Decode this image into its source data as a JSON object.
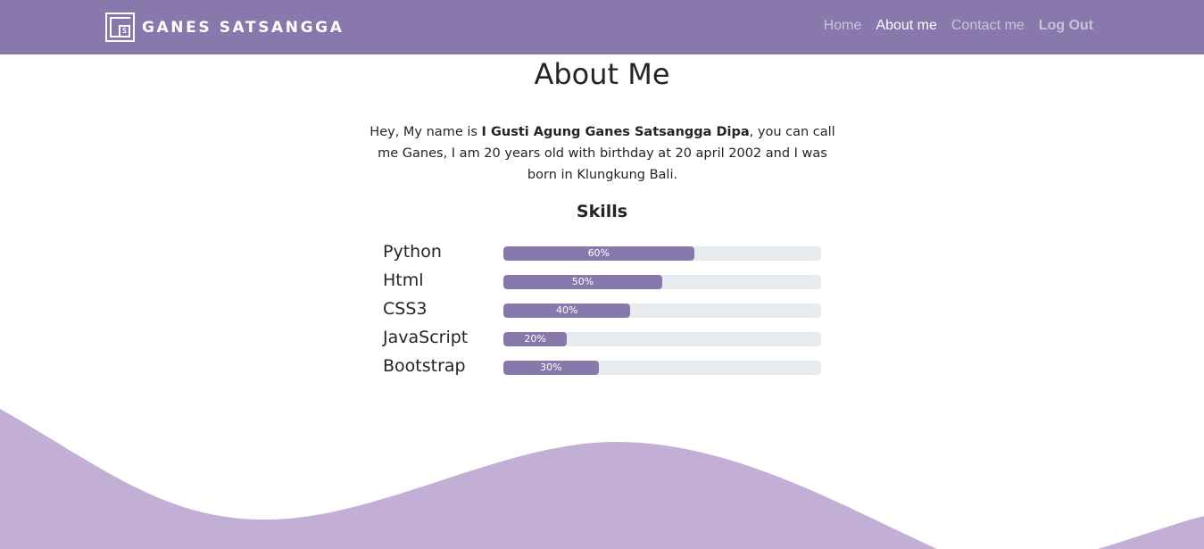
{
  "brand": {
    "logo_letter": "S",
    "name": "GANES SATSANGGA"
  },
  "nav": {
    "items": [
      {
        "label": "Home"
      },
      {
        "label": "About me"
      },
      {
        "label": "Contact me"
      },
      {
        "label": "Log Out"
      }
    ]
  },
  "page": {
    "title": "About Me",
    "intro_prefix": "Hey, My name is ",
    "intro_name": "I Gusti Agung Ganes Satsangga Dipa",
    "intro_suffix": ", you can call me Ganes, I am 20 years old with birthday at 20 april 2002 and I was born in Klungkung Bali.",
    "skills_title": "Skills"
  },
  "skills": [
    {
      "name": "Python",
      "percent": 60,
      "label": "60%"
    },
    {
      "name": "Html",
      "percent": 50,
      "label": "50%"
    },
    {
      "name": "CSS3",
      "percent": 40,
      "label": "40%"
    },
    {
      "name": "JavaScript",
      "percent": 20,
      "label": "20%"
    },
    {
      "name": "Bootstrap",
      "percent": 30,
      "label": "30%"
    }
  ],
  "colors": {
    "navbar": "#8878ab",
    "progress_fill": "#8878ab",
    "progress_track": "#e9ecef",
    "wave": "#c3aed6"
  }
}
